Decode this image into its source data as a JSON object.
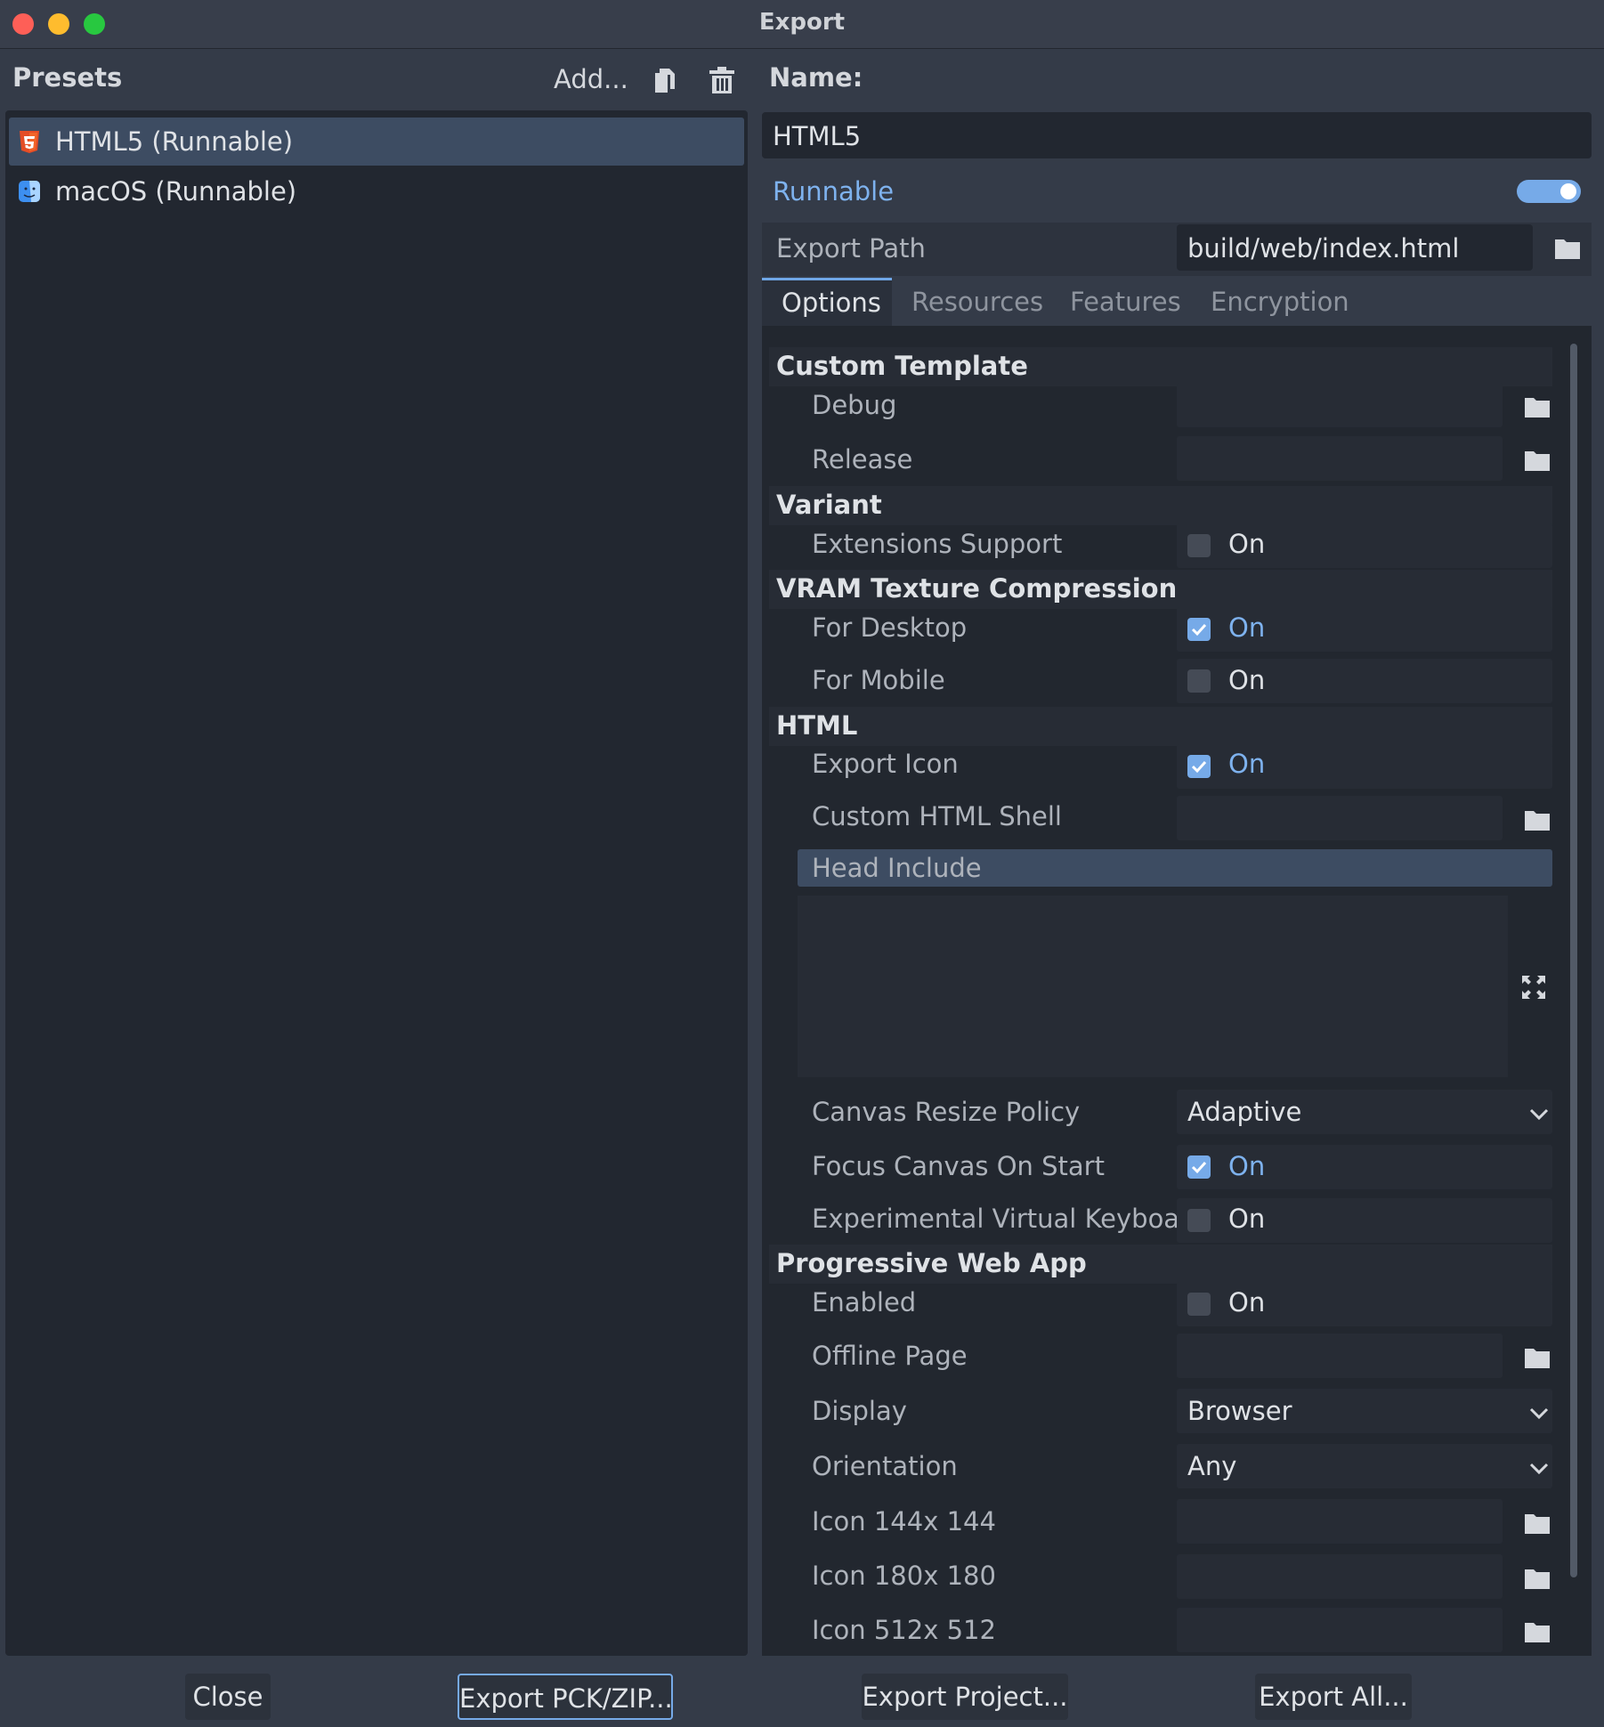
{
  "window": {
    "title": "Export"
  },
  "presets": {
    "header": "Presets",
    "add_label": "Add...",
    "items": [
      {
        "label": "HTML5 (Runnable)",
        "icon": "html5-icon",
        "selected": true
      },
      {
        "label": "macOS (Runnable)",
        "icon": "macos-finder-icon",
        "selected": false
      }
    ]
  },
  "editor": {
    "name_label": "Name:",
    "name_value": "HTML5",
    "runnable_label": "Runnable",
    "runnable_on": true,
    "export_path_label": "Export Path",
    "export_path_value": "build/web/index.html"
  },
  "tabs": [
    "Options",
    "Resources",
    "Features",
    "Encryption"
  ],
  "options": {
    "sections": {
      "custom_template": "Custom Template",
      "variant": "Variant",
      "vram": "VRAM Texture Compression",
      "html": "HTML",
      "pwa": "Progressive Web App"
    },
    "labels": {
      "debug": "Debug",
      "release": "Release",
      "extensions_support": "Extensions Support",
      "for_desktop": "For Desktop",
      "for_mobile": "For Mobile",
      "export_icon": "Export Icon",
      "custom_html_shell": "Custom HTML Shell",
      "head_include": "Head Include",
      "canvas_resize_policy": "Canvas Resize Policy",
      "focus_canvas_on_start": "Focus Canvas On Start",
      "experimental_virtual_keyboard": "Experimental Virtual Keyboard",
      "enabled": "Enabled",
      "offline_page": "Offline Page",
      "display": "Display",
      "orientation": "Orientation",
      "icon_144": "Icon 144x 144",
      "icon_180": "Icon 180x 180",
      "icon_512": "Icon 512x 512"
    },
    "on_text": "On",
    "checked": {
      "extensions_support": false,
      "for_desktop": true,
      "for_mobile": false,
      "export_icon": true,
      "focus_canvas_on_start": true,
      "experimental_virtual_keyboard": false,
      "enabled": false
    },
    "selects": {
      "canvas_resize_policy": "Adaptive",
      "display": "Browser",
      "orientation": "Any"
    }
  },
  "buttons": {
    "close": "Close",
    "export_pck": "Export PCK/ZIP...",
    "export_project": "Export Project...",
    "export_all": "Export All..."
  },
  "colors": {
    "accent": "#76aae8",
    "selected_bg": "#3d4c62",
    "panel_bg": "#222730"
  }
}
